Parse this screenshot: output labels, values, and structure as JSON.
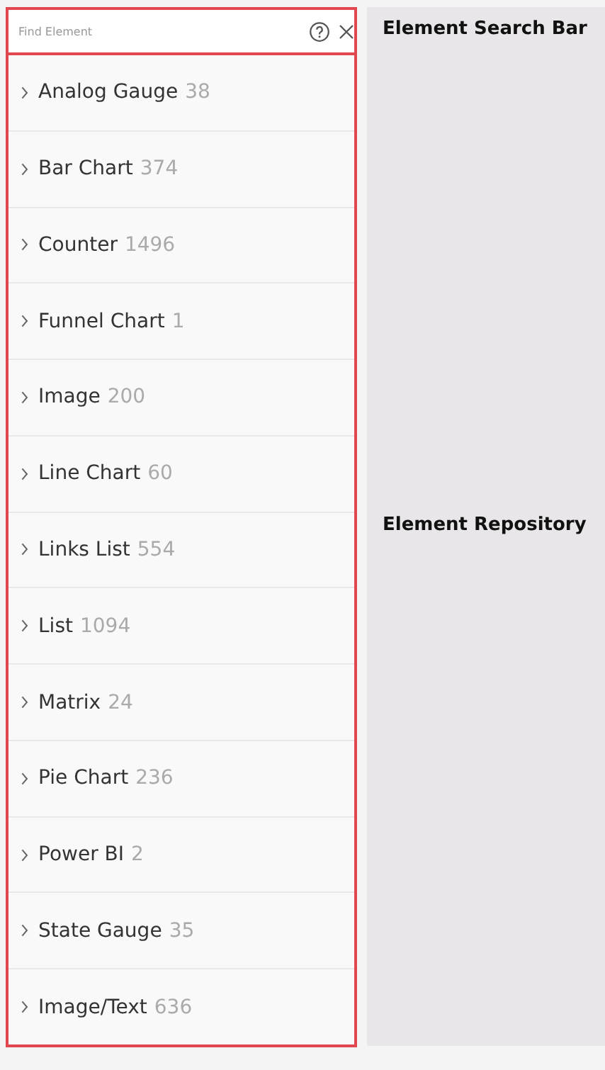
{
  "search": {
    "placeholder": "Find Element"
  },
  "elements": [
    {
      "name": "Analog Gauge",
      "count": "38"
    },
    {
      "name": "Bar Chart",
      "count": "374"
    },
    {
      "name": "Counter",
      "count": "1496"
    },
    {
      "name": "Funnel Chart",
      "count": "1"
    },
    {
      "name": "Image",
      "count": "200"
    },
    {
      "name": "Line Chart",
      "count": "60"
    },
    {
      "name": "Links List",
      "count": "554"
    },
    {
      "name": "List",
      "count": "1094"
    },
    {
      "name": "Matrix",
      "count": "24"
    },
    {
      "name": "Pie Chart",
      "count": "236"
    },
    {
      "name": "Power BI",
      "count": "2"
    },
    {
      "name": "State Gauge",
      "count": "35"
    },
    {
      "name": "Image/Text",
      "count": "636"
    }
  ],
  "annotations": [
    "Element Search Bar",
    "Element Repository"
  ]
}
